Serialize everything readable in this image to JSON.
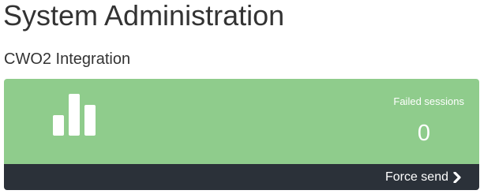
{
  "page": {
    "title": "System Administration"
  },
  "section": {
    "title": "CWO2 Integration"
  },
  "panel": {
    "icon": "bar-chart-icon",
    "stat_label": "Failed sessions",
    "stat_value": "0",
    "footer_label": "Force send",
    "footer_icon": "chevron-right-icon",
    "colors": {
      "body": "#8fcc8c",
      "footer": "#2b3139",
      "text": "#ffffff"
    }
  }
}
